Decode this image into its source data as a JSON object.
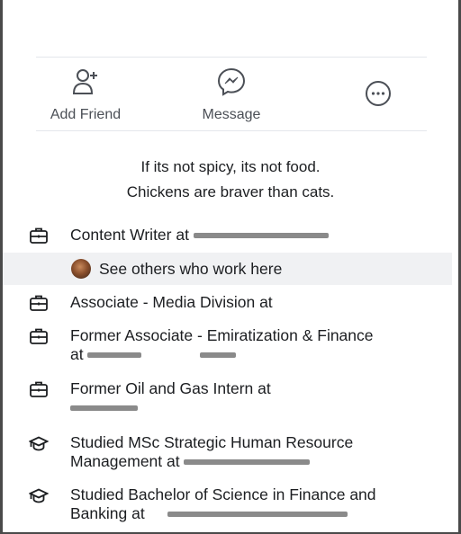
{
  "actions": {
    "add_friend": "Add Friend",
    "message": "Message"
  },
  "bio": {
    "line1": "If its not spicy, its not food.",
    "line2": "Chickens are braver than cats."
  },
  "work": [
    {
      "text": "Content Writer at"
    },
    {
      "text": "See others who work here"
    },
    {
      "text": "Associate - Media Division at"
    },
    {
      "text_line1": "Former Associate - Emiratization & Finance",
      "text_line2": "at"
    },
    {
      "text": "Former Oil and Gas Intern at"
    }
  ],
  "education": [
    {
      "text_line1": "Studied MSc Strategic Human Resource",
      "text_line2": "Management at"
    },
    {
      "text_line1": "Studied Bachelor of Science in Finance and",
      "text_line2": "Banking at"
    }
  ]
}
